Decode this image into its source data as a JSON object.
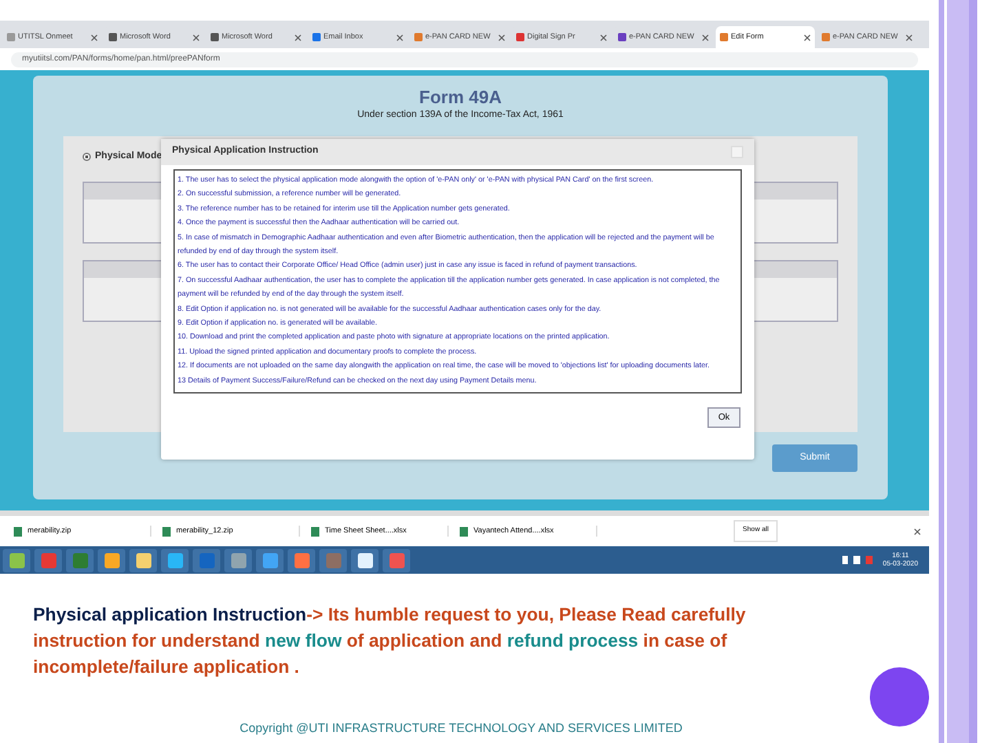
{
  "browser": {
    "tabs": [
      {
        "label": "UTITSL Onmeet",
        "selected": false
      },
      {
        "label": "Microsoft Word",
        "selected": false
      },
      {
        "label": "Microsoft Word",
        "selected": false
      },
      {
        "label": "Email Inbox",
        "selected": false
      },
      {
        "label": "e-PAN CARD NEW",
        "selected": false
      },
      {
        "label": "Digital Sign Pr",
        "selected": false
      },
      {
        "label": "e-PAN CARD NEW",
        "selected": false
      },
      {
        "label": "Edit Form",
        "selected": true
      },
      {
        "label": "e-PAN CARD NEW",
        "selected": false
      }
    ],
    "address": "myutiitsl.com/PAN/forms/home/pan.html/preePANform"
  },
  "page": {
    "title": "Form 49A",
    "subtitle": "Under section 139A of the Income-Tax Act, 1961",
    "mode_option": {
      "label": "Physical Mode",
      "selected": true
    },
    "submit": "Submit"
  },
  "modal": {
    "title": "Physical Application Instruction",
    "instructions": [
      "1. The user has to select the physical application mode alongwith the option of 'e-PAN only' or 'e-PAN with physical PAN Card' on the first screen.",
      "2. On successful submission, a reference number will be generated.",
      "3. The reference number has to be retained for interim use till the Application number gets generated.",
      "4. Once the payment is successful then the Aadhaar authentication will be carried out.",
      "5. In case of mismatch in Demographic Aadhaar authentication and even after Biometric authentication, then the application will be rejected and the payment will be refunded by end of day through the system itself.",
      "6. The user has to contact their Corporate Office/ Head Office (admin user) just in case any issue is faced in refund of payment transactions.",
      "7. On successful Aadhaar authentication, the user has to complete the application till the application number gets generated. In case application is not completed, the payment will be refunded by end of the day through the system itself.",
      "8. Edit Option if application no. is not generated will be available for the successful Aadhaar authentication cases only for the day.",
      "9. Edit Option if application no. is generated will be available.",
      "10. Download and print the completed application and paste photo with signature at appropriate locations on the printed application.",
      "11. Upload the signed printed application and documentary proofs to complete the process.",
      "12. If documents are not uploaded on the same day alongwith the application on real time, the case will be moved to 'objections list' for uploading documents later.",
      "13 Details of Payment Success/Failure/Refund can be checked on the next day using Payment Details menu."
    ],
    "ok": "Ok"
  },
  "downloads": {
    "items": [
      "merability.zip",
      "merability_12.zip",
      "Time Sheet Sheet....xlsx",
      "Vayantech Attend....xlsx"
    ],
    "show_all": "Show all"
  },
  "taskbar": {
    "time": "16:11",
    "date": "05-03-2020"
  },
  "caption": {
    "segments": [
      {
        "text": "Physical application Instruction",
        "color": "#0b1f4a"
      },
      {
        "text": "-> Its humble request to you, Please Read carefully instruction for understand ",
        "color": "#c8481c"
      },
      {
        "text": "new flow ",
        "color": "#198c8c"
      },
      {
        "text": "of application and ",
        "color": "#c8481c"
      },
      {
        "text": "refund process ",
        "color": "#198c8c"
      },
      {
        "text": "in case of incomplete/failure application .",
        "color": "#c8481c"
      }
    ]
  },
  "copyright": "Copyright @UTI INFRASTRUCTURE TECHNOLOGY AND SERVICES LIMITED"
}
